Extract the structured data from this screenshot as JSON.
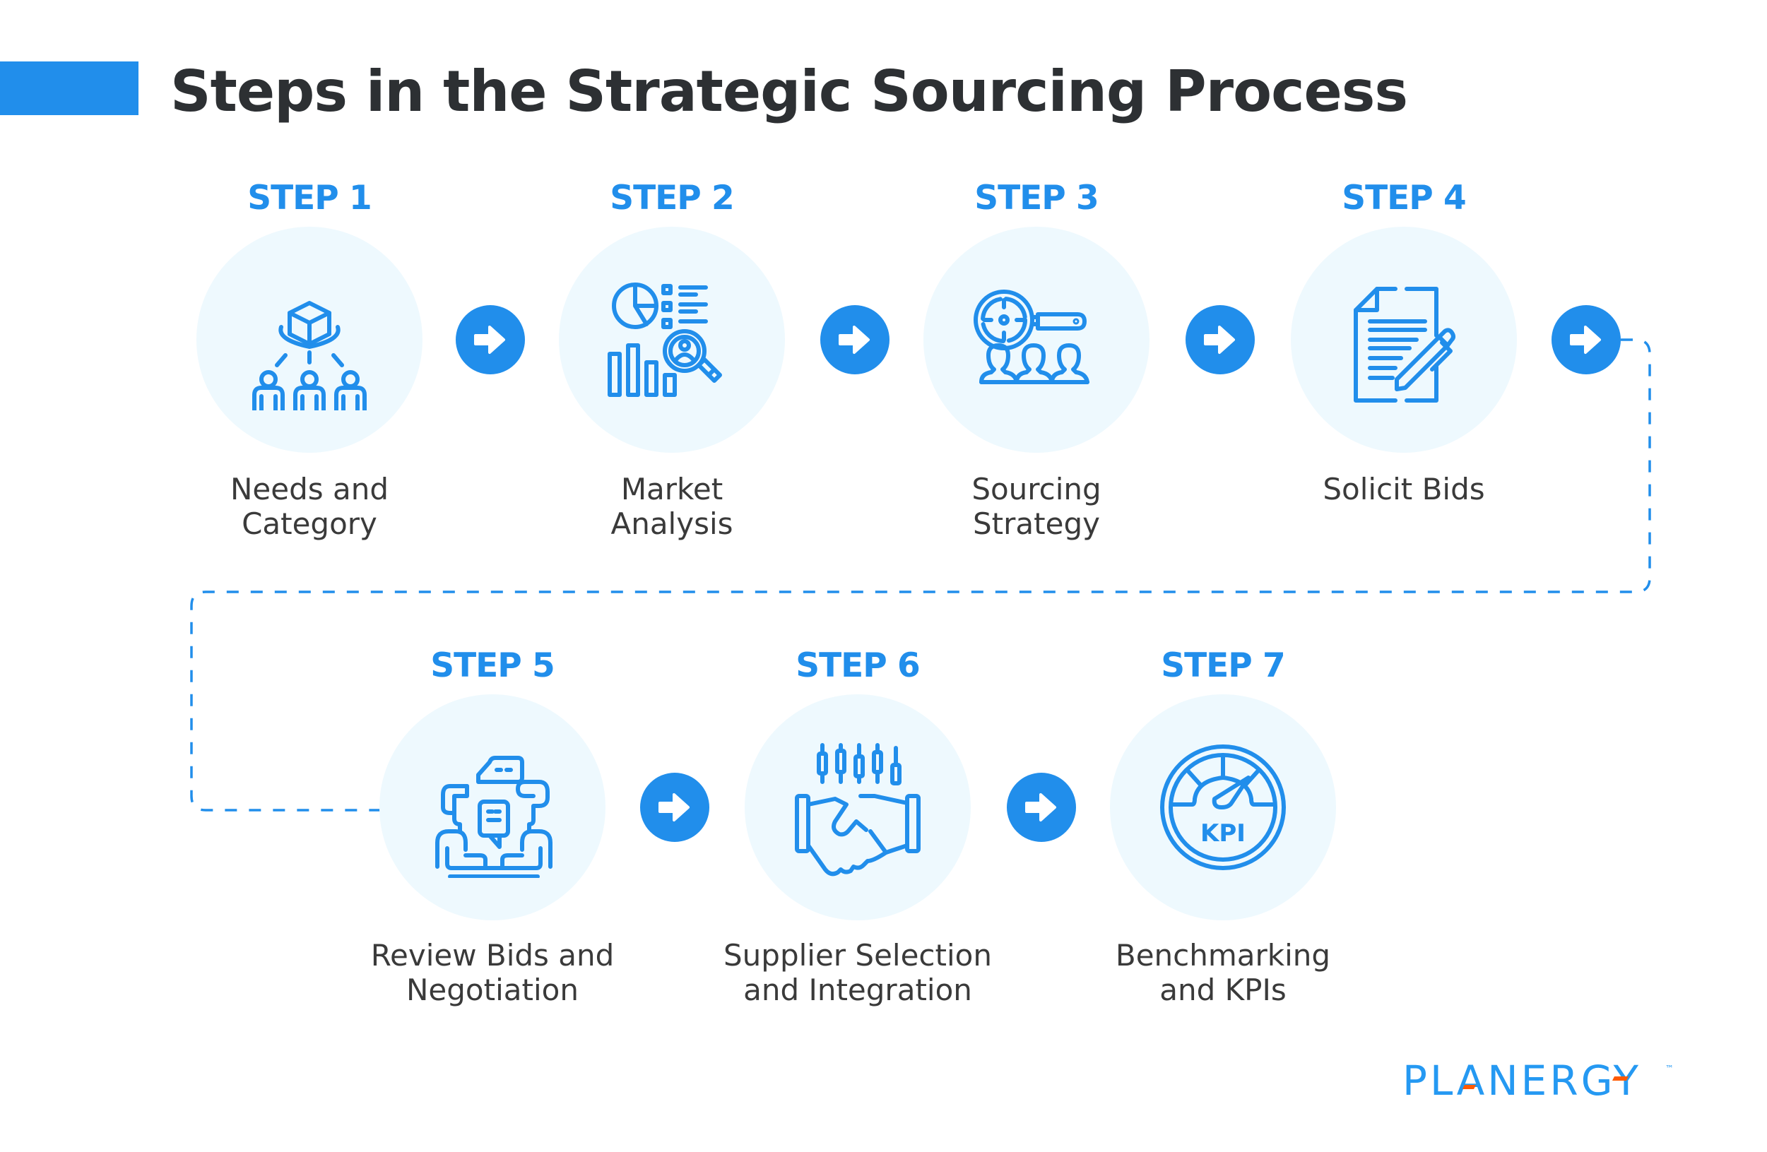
{
  "title": "Steps in the Strategic Sourcing Process",
  "colors": {
    "accent": "#218eeb",
    "circle_bg": "#eef9fe",
    "title_text": "#2d3033",
    "body_text": "#3a3a3a",
    "logo_blue": "#2599f2",
    "logo_orange": "#ff5a00"
  },
  "steps": [
    {
      "label": "STEP 1",
      "name_line1": "Needs and",
      "name_line2": "Category",
      "icon": "supply-network-icon"
    },
    {
      "label": "STEP 2",
      "name_line1": "Market",
      "name_line2": "Analysis",
      "icon": "market-analysis-icon"
    },
    {
      "label": "STEP 3",
      "name_line1": "Sourcing",
      "name_line2": "Strategy",
      "icon": "target-search-icon"
    },
    {
      "label": "STEP 4",
      "name_line1": "Solicit Bids",
      "name_line2": "",
      "icon": "document-pen-icon"
    },
    {
      "label": "STEP 5",
      "name_line1": "Review Bids and",
      "name_line2": "Negotiation",
      "icon": "negotiation-icon"
    },
    {
      "label": "STEP 6",
      "name_line1": "Supplier Selection",
      "name_line2": "and Integration",
      "icon": "handshake-icon"
    },
    {
      "label": "STEP 7",
      "name_line1": "Benchmarking",
      "name_line2": "and KPIs",
      "icon": "kpi-gauge-icon"
    }
  ],
  "kpi_icon_text": "KPI",
  "logo": {
    "text": "PLANERGY",
    "trademark": "™"
  }
}
